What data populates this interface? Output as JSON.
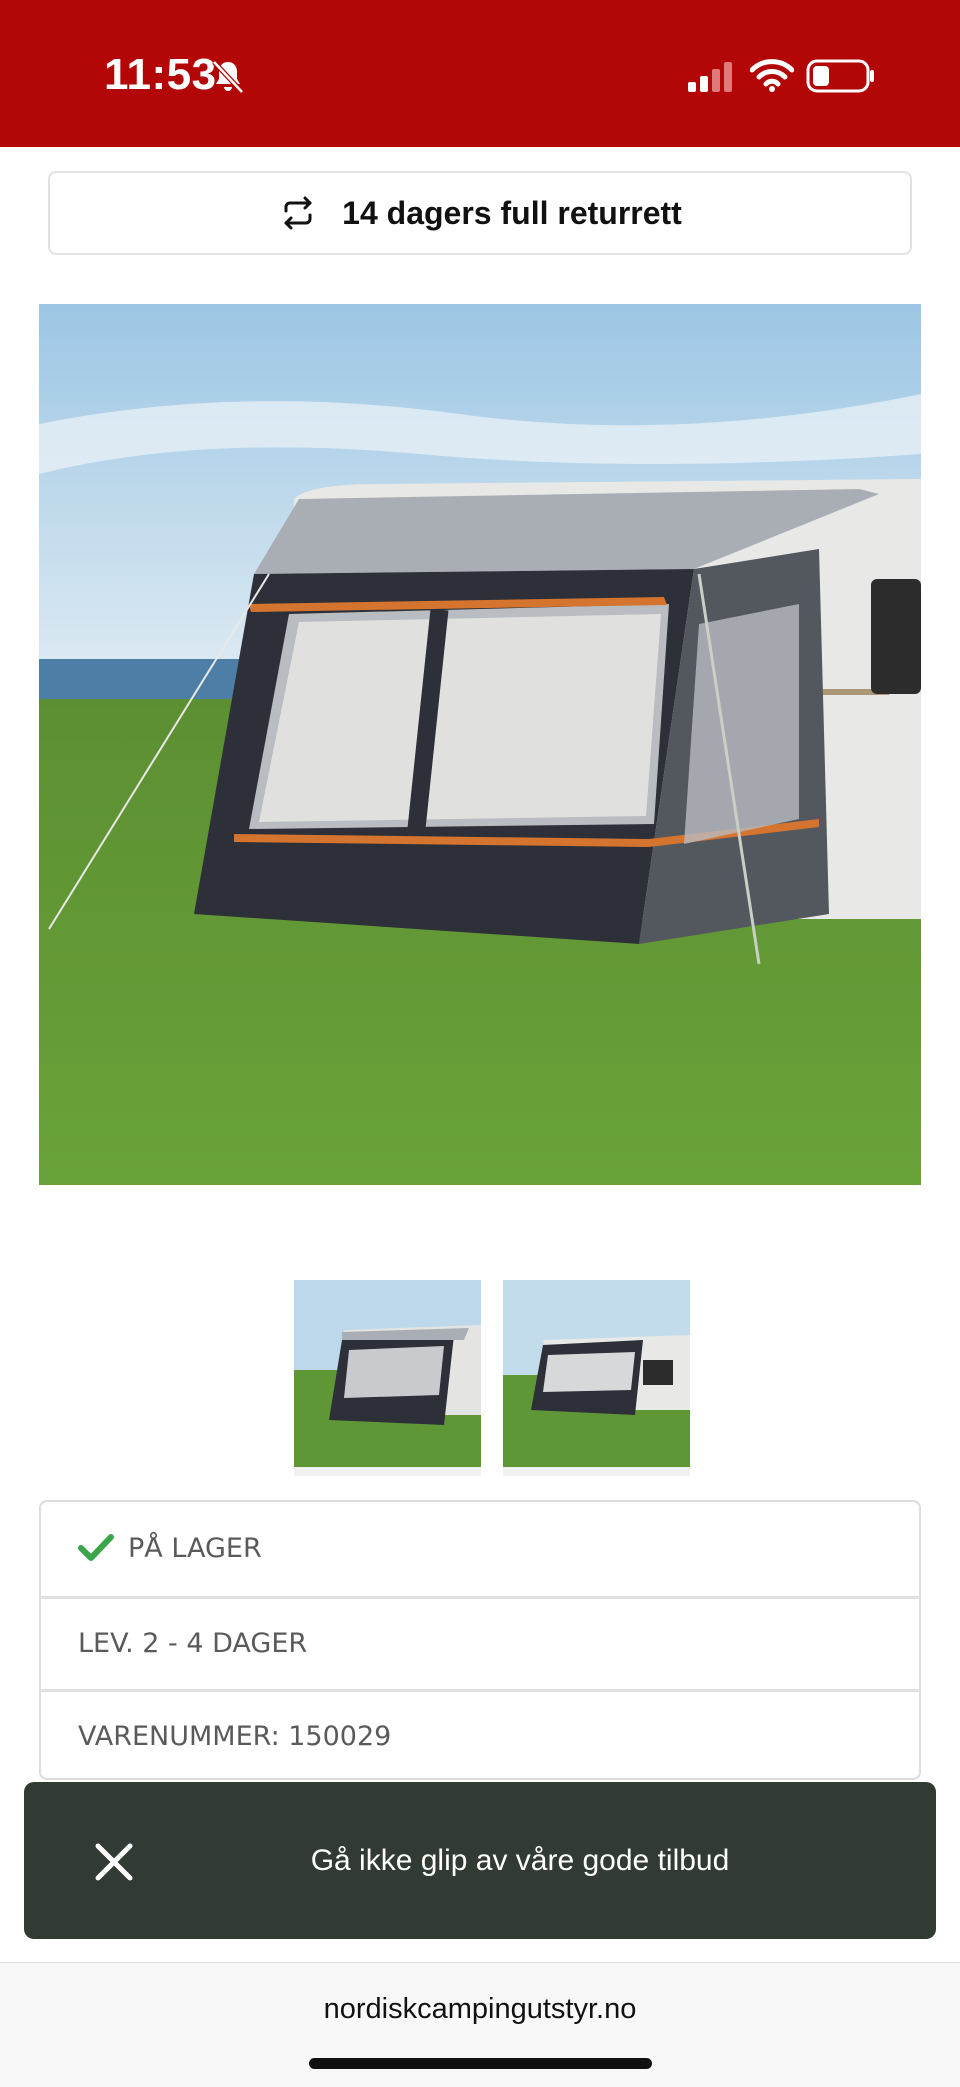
{
  "status_bar": {
    "time": "11:53",
    "bg_color": "#b30606"
  },
  "banner": {
    "text": "14 dagers full returrett",
    "icon": "repeat-icon"
  },
  "gallery": {
    "main_image": "caravan-awning-photo",
    "thumbnails": [
      "awning-thumb-1",
      "awning-thumb-2"
    ]
  },
  "stock": {
    "status": "PÅ LAGER",
    "delivery": "LEV. 2 - 4 DAGER",
    "item_number": "VARENUMMER: 150029",
    "status_icon": "check-icon",
    "check_color": "#3aa54a"
  },
  "toast": {
    "text": "Gå ikke glip av våre gode tilbud",
    "bg_color": "#313b34"
  },
  "browser": {
    "url": "nordiskcampingutstyr.no"
  }
}
